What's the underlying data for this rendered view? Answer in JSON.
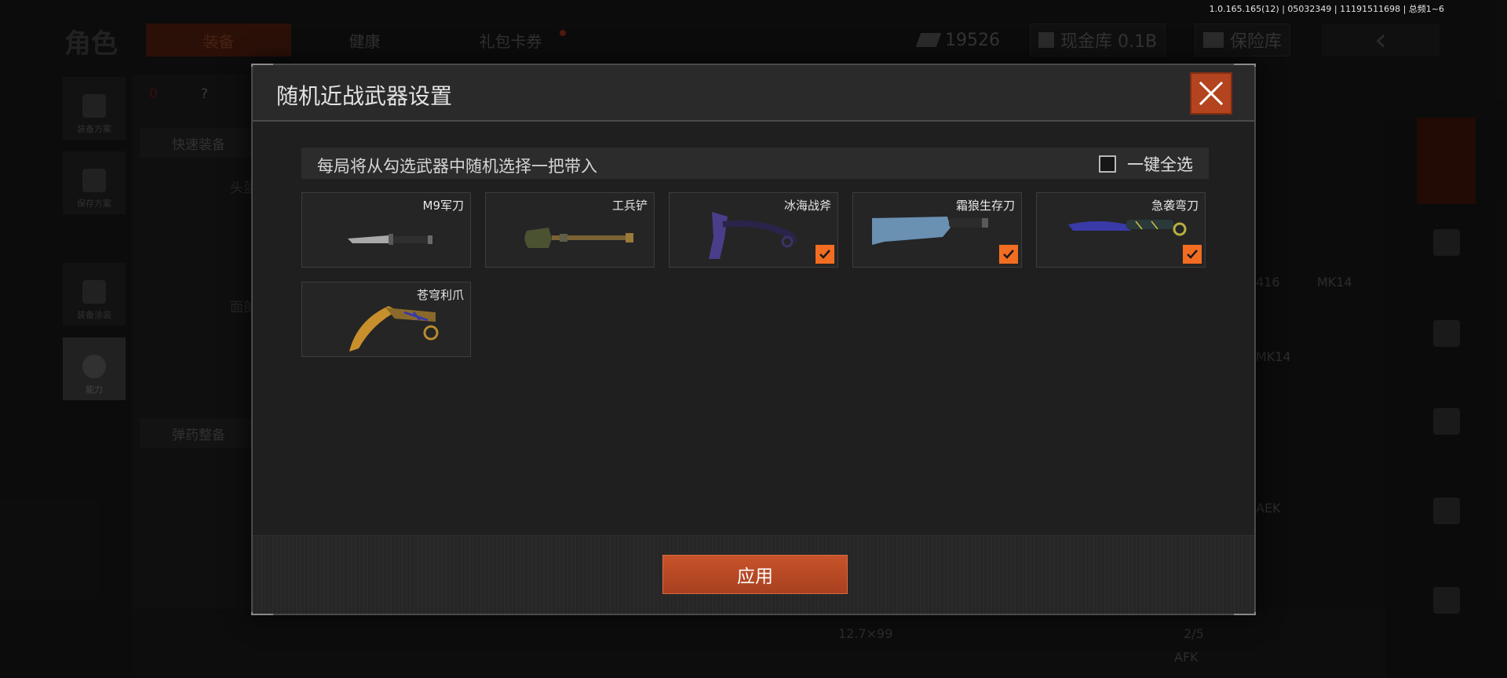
{
  "version_info": "1.0.165.165(12) | 05032349 | 11191511698 | 总频1~6",
  "background": {
    "page_title": "角色",
    "tabs": [
      {
        "label": "装备",
        "active": true
      },
      {
        "label": "健康",
        "active": false
      },
      {
        "label": "礼包卡券",
        "active": false
      }
    ],
    "currency_amount": "19526",
    "cash_vault": "现金库 0.1B",
    "safe": "保险库",
    "back_icon": "chevron-left-icon",
    "side_buttons": [
      "装备方案",
      "保存方案",
      "装备涂装",
      "能力"
    ],
    "left_panel": {
      "weight": "0",
      "help": "?",
      "quick_equip": "快速装备",
      "head": "头盔",
      "face": "面部",
      "ammo_equip": "弹药整备"
    },
    "bg_labels": [
      "416",
      "MK14",
      "MK14",
      "AEK",
      "12.7×99",
      "2/5",
      "AFK"
    ]
  },
  "modal": {
    "title": "随机近战武器设置",
    "close_icon": "close-icon",
    "info_text": "每局将从勾选武器中随机选择一把带入",
    "select_all_label": "一键全选",
    "select_all_checked": false,
    "weapons": [
      {
        "name": "M9军刀",
        "checked": false
      },
      {
        "name": "工兵铲",
        "checked": false
      },
      {
        "name": "冰海战斧",
        "checked": true
      },
      {
        "name": "霜狼生存刀",
        "checked": true
      },
      {
        "name": "急袭弯刀",
        "checked": true
      },
      {
        "name": "苍穹利爪",
        "checked": false
      }
    ],
    "apply_label": "应用",
    "accent_color": "#f26d21",
    "button_color": "#b4441f"
  }
}
